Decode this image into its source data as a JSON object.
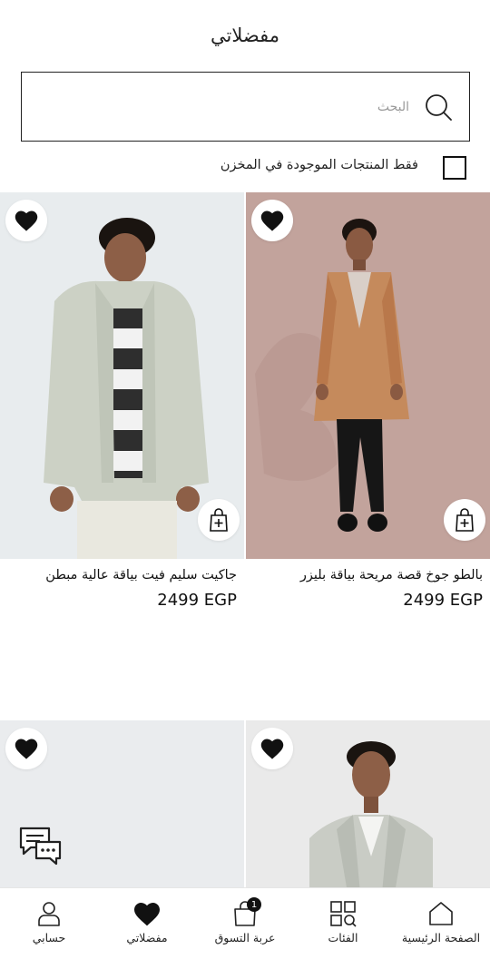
{
  "header": {
    "title": "مفضلاتي"
  },
  "search": {
    "placeholder": "البحث",
    "value": ""
  },
  "filter": {
    "in_stock_label": "فقط المنتجات الموجودة في المخزن",
    "checked": false
  },
  "products": [
    {
      "name": "بالطو جوخ قصة مريحة بياقة بليزر",
      "price": "2499 EGP",
      "favorited": true
    },
    {
      "name": "جاكيت سليم فيت بياقة عالية مبطن",
      "price": "2499 EGP",
      "favorited": true
    },
    {
      "name": "",
      "price": "",
      "favorited": true
    },
    {
      "name": "",
      "price": "",
      "favorited": true
    }
  ],
  "bottom_nav": [
    {
      "label": "الصفحة الرئيسية",
      "icon": "home-icon"
    },
    {
      "label": "الفئات",
      "icon": "categories-icon"
    },
    {
      "label": "عربة التسوق",
      "icon": "cart-icon",
      "badge": "1"
    },
    {
      "label": "مفضلاتي",
      "icon": "heart-icon"
    },
    {
      "label": "حسابي",
      "icon": "user-icon"
    }
  ]
}
